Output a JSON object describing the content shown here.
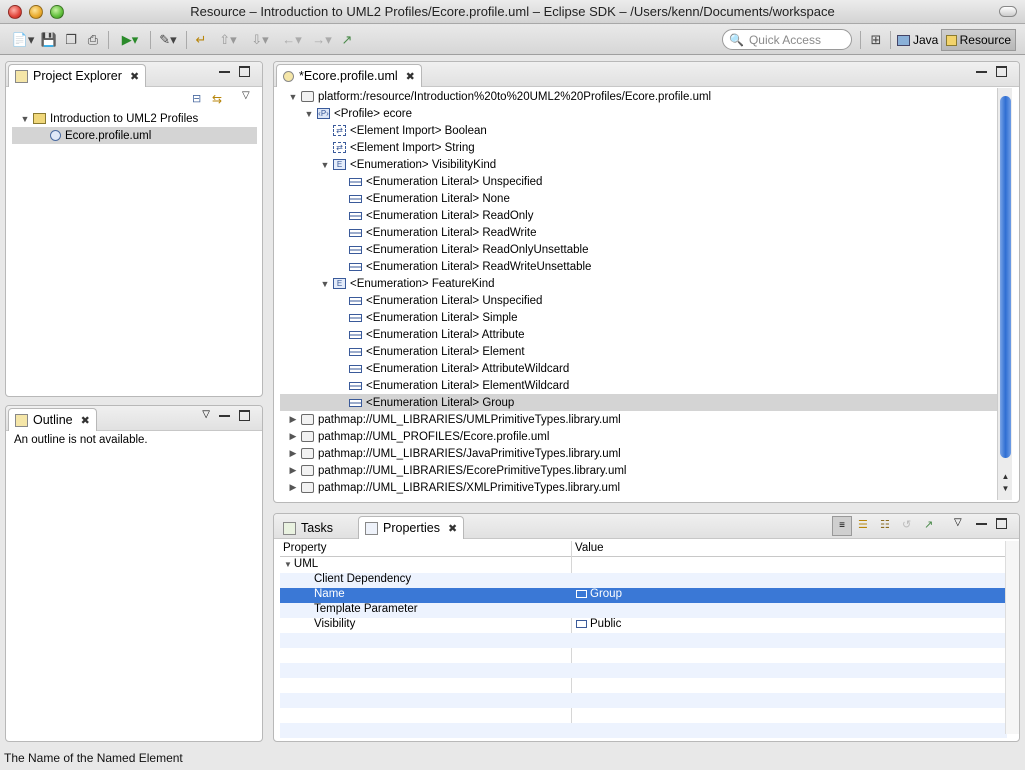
{
  "window": {
    "title": "Resource – Introduction to UML2 Profiles/Ecore.profile.uml – Eclipse SDK – /Users/kenn/Documents/workspace"
  },
  "toolbar": {
    "quick_access_placeholder": "Quick Access",
    "perspectives": [
      {
        "label": "Java",
        "active": false
      },
      {
        "label": "Resource",
        "active": true
      }
    ]
  },
  "project_explorer": {
    "tab_label": "Project Explorer",
    "items": [
      {
        "label": "Introduction to UML2 Profiles",
        "level": 0,
        "expanded": true
      },
      {
        "label": "Ecore.profile.uml",
        "level": 1,
        "selected": true
      }
    ]
  },
  "outline": {
    "tab_label": "Outline",
    "message": "An outline is not available."
  },
  "editor": {
    "tab_label": "*Ecore.profile.uml",
    "tree": [
      {
        "label": "platform:/resource/Introduction%20to%20UML2%20Profiles/Ecore.profile.uml",
        "level": 0,
        "twisty": "open",
        "icon": "res"
      },
      {
        "label": "<Profile> ecore",
        "level": 1,
        "twisty": "open",
        "icon": "prof"
      },
      {
        "label": "<Element Import> Boolean",
        "level": 2,
        "twisty": "",
        "icon": "imp"
      },
      {
        "label": "<Element Import> String",
        "level": 2,
        "twisty": "",
        "icon": "imp"
      },
      {
        "label": "<Enumeration> VisibilityKind",
        "level": 2,
        "twisty": "open",
        "icon": "enum"
      },
      {
        "label": "<Enumeration Literal> Unspecified",
        "level": 3,
        "twisty": "",
        "icon": "lit"
      },
      {
        "label": "<Enumeration Literal> None",
        "level": 3,
        "twisty": "",
        "icon": "lit"
      },
      {
        "label": "<Enumeration Literal> ReadOnly",
        "level": 3,
        "twisty": "",
        "icon": "lit"
      },
      {
        "label": "<Enumeration Literal> ReadWrite",
        "level": 3,
        "twisty": "",
        "icon": "lit"
      },
      {
        "label": "<Enumeration Literal> ReadOnlyUnsettable",
        "level": 3,
        "twisty": "",
        "icon": "lit"
      },
      {
        "label": "<Enumeration Literal> ReadWriteUnsettable",
        "level": 3,
        "twisty": "",
        "icon": "lit"
      },
      {
        "label": "<Enumeration> FeatureKind",
        "level": 2,
        "twisty": "open",
        "icon": "enum"
      },
      {
        "label": "<Enumeration Literal> Unspecified",
        "level": 3,
        "twisty": "",
        "icon": "lit"
      },
      {
        "label": "<Enumeration Literal> Simple",
        "level": 3,
        "twisty": "",
        "icon": "lit"
      },
      {
        "label": "<Enumeration Literal> Attribute",
        "level": 3,
        "twisty": "",
        "icon": "lit"
      },
      {
        "label": "<Enumeration Literal> Element",
        "level": 3,
        "twisty": "",
        "icon": "lit"
      },
      {
        "label": "<Enumeration Literal> AttributeWildcard",
        "level": 3,
        "twisty": "",
        "icon": "lit"
      },
      {
        "label": "<Enumeration Literal> ElementWildcard",
        "level": 3,
        "twisty": "",
        "icon": "lit"
      },
      {
        "label": "<Enumeration Literal> Group",
        "level": 3,
        "twisty": "",
        "icon": "lit",
        "selected": true
      },
      {
        "label": "pathmap://UML_LIBRARIES/UMLPrimitiveTypes.library.uml",
        "level": 0,
        "twisty": "closed",
        "icon": "res"
      },
      {
        "label": "pathmap://UML_PROFILES/Ecore.profile.uml",
        "level": 0,
        "twisty": "closed",
        "icon": "res"
      },
      {
        "label": "pathmap://UML_LIBRARIES/JavaPrimitiveTypes.library.uml",
        "level": 0,
        "twisty": "closed",
        "icon": "res"
      },
      {
        "label": "pathmap://UML_LIBRARIES/EcorePrimitiveTypes.library.uml",
        "level": 0,
        "twisty": "closed",
        "icon": "res"
      },
      {
        "label": "pathmap://UML_LIBRARIES/XMLPrimitiveTypes.library.uml",
        "level": 0,
        "twisty": "closed",
        "icon": "res"
      }
    ]
  },
  "bottom_panel": {
    "tabs": [
      {
        "label": "Tasks",
        "active": false
      },
      {
        "label": "Properties",
        "active": true
      }
    ],
    "columns": [
      "Property",
      "Value"
    ],
    "rows": [
      {
        "property": "UML",
        "value": "",
        "group": true
      },
      {
        "property": "Client Dependency",
        "value": ""
      },
      {
        "property": "Name",
        "value": "Group",
        "selected": true,
        "value_icon": true
      },
      {
        "property": "Template Parameter",
        "value": ""
      },
      {
        "property": "Visibility",
        "value": "Public",
        "value_icon": true
      }
    ]
  },
  "status": {
    "text": "The Name of the Named Element"
  },
  "colors": {
    "selection_blue": "#3a78d6",
    "selection_gray": "#d4d4d4"
  }
}
